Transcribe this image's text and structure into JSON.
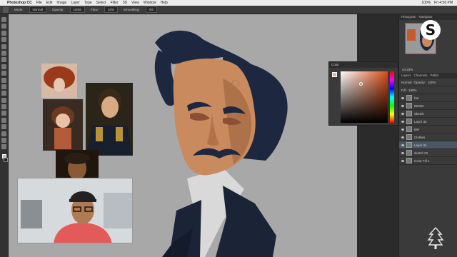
{
  "menubar": {
    "app_name": "Photoshop CC",
    "items": [
      "File",
      "Edit",
      "Image",
      "Layer",
      "Type",
      "Select",
      "Filter",
      "3D",
      "View",
      "Window",
      "Help"
    ],
    "clock": "Fri 4:56 PM",
    "battery": "100%"
  },
  "options_bar": {
    "mode_label": "Mode:",
    "mode_value": "Normal",
    "opacity_label": "Opacity:",
    "opacity_value": "100%",
    "flow_label": "Flow:",
    "flow_value": "43%",
    "smoothing_label": "Smoothing:",
    "smoothing_value": "0%"
  },
  "color_panel": {
    "title": "Color",
    "foreground_color": "#e0b8a0"
  },
  "right_panel": {
    "nav_tabs": [
      "Histogram",
      "Navigator"
    ],
    "zoom": "44.33%",
    "layer_tabs": [
      "Layers",
      "Channels",
      "Paths"
    ],
    "blend_mode": "Normal",
    "opacity_label": "Opacity:",
    "opacity_value": "100%",
    "fill_label": "Fill:",
    "fill_value": "100%",
    "layers": [
      {
        "name": "hat"
      },
      {
        "name": "DEMO"
      },
      {
        "name": "Sketch"
      },
      {
        "name": "Layer 33"
      },
      {
        "name": "BW"
      },
      {
        "name": "Clothes"
      },
      {
        "name": "Layer 34"
      },
      {
        "name": "sketch 02"
      },
      {
        "name": "Color Fill 1"
      }
    ]
  },
  "badge": {
    "letter": "S"
  }
}
